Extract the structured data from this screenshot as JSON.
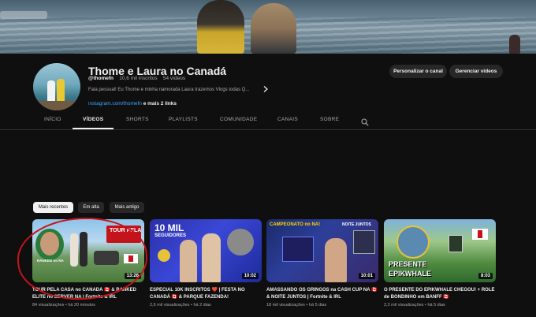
{
  "channel": {
    "name": "Thome e Laura no Canadá",
    "handle": "@thomefn",
    "subscribers": "10,6 mil inscritos",
    "videos_count": "54 vídeos",
    "description": "Fala pessoal! Eu Thome e minha namorada Laura trazemos Vlogs todas Q...",
    "link_url": "instagram.com/thomefn",
    "link_more": "e mais 2 links"
  },
  "buttons": {
    "customize": "Personalizar o canal",
    "manage": "Gerenciar vídeos"
  },
  "tabs": [
    {
      "label": "INÍCIO",
      "active": false
    },
    {
      "label": "VÍDEOS",
      "active": true
    },
    {
      "label": "SHORTS",
      "active": false
    },
    {
      "label": "PLAYLISTS",
      "active": false
    },
    {
      "label": "COMUNIDADE",
      "active": false
    },
    {
      "label": "CANAIS",
      "active": false
    },
    {
      "label": "SOBRE",
      "active": false
    }
  ],
  "filters": [
    {
      "label": "Mais recentes",
      "active": true
    },
    {
      "label": "Em alta",
      "active": false
    },
    {
      "label": "Mais antigo",
      "active": false
    }
  ],
  "videos": [
    {
      "title": "TOUR PELA CASA no CANADÁ 🇨🇦 & RANKED ELITE no SERVER NA | Fortnite & IRL",
      "duration": "13:26",
      "views": "84 visualizações",
      "age": "há 20 minutos",
      "thumb_text": [
        "TOUR PELA",
        "RANKED no NA"
      ]
    },
    {
      "title": "ESPECIAL 10K INSCRITOS ❤️ | FESTA NO CANADÁ 🇨🇦 & PARQUE FAZENDA!",
      "duration": "10:02",
      "views": "2,6 mil visualizações",
      "age": "há 2 dias",
      "thumb_text": [
        "10 MIL",
        "SEGUIDORES"
      ]
    },
    {
      "title": "AMASSANDO OS GRINGOS na CASH CUP NA 🇨🇦 & NOITE JUNTOS | Fortnite & IRL",
      "duration": "10:01",
      "views": "18 mil visualizações",
      "age": "há 5 dias",
      "thumb_text": [
        "CAMPEONATO no NA!",
        "NOITE JUNTOS"
      ]
    },
    {
      "title": "O PRESENTE DO EPIKWHALE CHEGOU! + ROLÊ de BONDINHO em BANFF 🇨🇦",
      "duration": "8:03",
      "views": "2,2 mil visualizações",
      "age": "há 5 dias",
      "thumb_text": [
        "PRESENTE",
        "EPIKWHALE"
      ]
    }
  ],
  "meta_separator": "•",
  "colors": {
    "background": "#0f0f0f",
    "link": "#3ea6ff",
    "annotation": "#c4141b",
    "chip": "#272727"
  },
  "icons": {
    "search_tab": "search-icon",
    "desc_more": "chevron-right-icon"
  }
}
